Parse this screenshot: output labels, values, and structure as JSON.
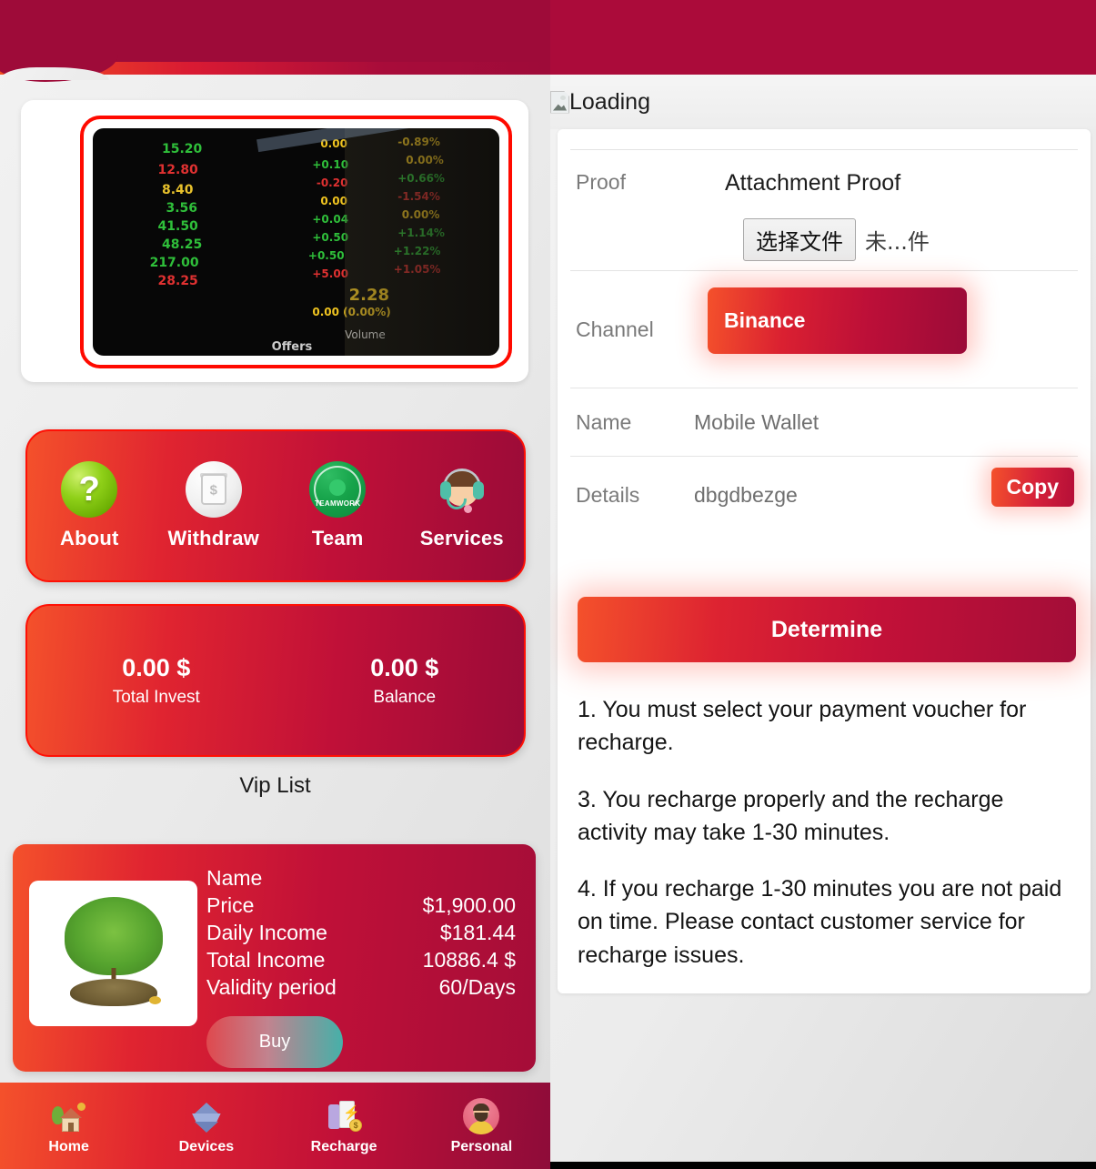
{
  "left": {
    "banner": {
      "alt": "stock-market-ticker-board",
      "ticks": [
        {
          "price": "15.20",
          "change": "0.00",
          "pct": "-0.89%"
        },
        {
          "price": "12.80",
          "change": "+0.10",
          "pct": "0.00%"
        },
        {
          "price": "8.40",
          "change": "-0.20",
          "pct": "+0.66%"
        },
        {
          "price": "3.56",
          "change": "0.00",
          "pct": "-1.54%"
        },
        {
          "price": "41.50",
          "change": "+0.04",
          "pct": "0.00%"
        },
        {
          "price": "48.25",
          "change": "+0.50",
          "pct": "+1.14%"
        },
        {
          "price": "217.00",
          "change": "+0.50",
          "pct": "+1.22%"
        },
        {
          "price": "28.25",
          "change": "+5.00",
          "pct": "+1.05%"
        }
      ],
      "summary_value": "2.28",
      "summary_change": "0.00 (0.00%)",
      "volume_label": "Volume",
      "offers_label": "Offers"
    },
    "menu": [
      {
        "label": "About",
        "icon": "question-mark-icon"
      },
      {
        "label": "Withdraw",
        "icon": "atm-machine-icon"
      },
      {
        "label": "Team",
        "icon": "teamwork-badge-icon"
      },
      {
        "label": "Services",
        "icon": "customer-support-headset-icon"
      }
    ],
    "stats": [
      {
        "value": "0.00 $",
        "label": "Total Invest"
      },
      {
        "value": "0.00 $",
        "label": "Balance"
      }
    ],
    "vip_list_title": "Vip List",
    "product": {
      "thumb_alt": "money-tree-icon",
      "rows": [
        {
          "key": "Name",
          "value": ""
        },
        {
          "key": "Price",
          "value": "$1,900.00"
        },
        {
          "key": "Daily Income",
          "value": "$181.44"
        },
        {
          "key": "Total Income",
          "value": "10886.4 $"
        },
        {
          "key": "Validity period",
          "value": "60/Days"
        }
      ],
      "buy_label": "Buy"
    },
    "bottom_nav": [
      {
        "label": "Home",
        "icon": "home-icon"
      },
      {
        "label": "Devices",
        "icon": "devices-box-icon"
      },
      {
        "label": "Recharge",
        "icon": "recharge-phone-icon"
      },
      {
        "label": "Personal",
        "icon": "person-avatar-icon"
      }
    ]
  },
  "right": {
    "loading_text": "Loading",
    "broken_image_alt": "broken-image-icon",
    "proof": {
      "label": "Proof",
      "title": "Attachment Proof",
      "file_button": "选择文件",
      "file_name": "未...件"
    },
    "channel": {
      "label": "Channel",
      "selected": "Binance"
    },
    "name": {
      "label": "Name",
      "value": "Mobile Wallet"
    },
    "details": {
      "label": "Details",
      "value": "dbgdbezge",
      "copy_label": "Copy"
    },
    "determine_label": "Determine",
    "notes": [
      "1. You must select your payment voucher for recharge.",
      "3. You recharge properly and the recharge activity may take 1-30 minutes.",
      "4. If you recharge 1-30 minutes you are not paid on time. Please contact customer service for recharge issues."
    ]
  },
  "colors": {
    "header_crimson": "#9e0b39",
    "accent_orange": "#f4512b",
    "accent_red": "#ff1005",
    "card_deep_red": "#9b0b38"
  }
}
